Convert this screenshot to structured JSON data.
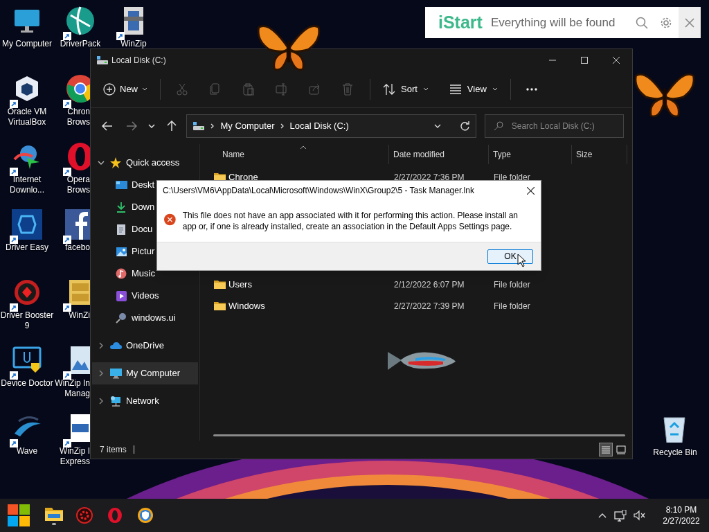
{
  "desktop_columns": [
    [
      {
        "label": "My Computer",
        "shortcut": false
      },
      {
        "label": "Oracle VM VirtualBox",
        "shortcut": true
      },
      {
        "label": "Internet Downlo...",
        "shortcut": true
      },
      {
        "label": "Driver Easy",
        "shortcut": true
      },
      {
        "label": "Driver Booster 9",
        "shortcut": true
      },
      {
        "label": "Device Doctor",
        "shortcut": true
      },
      {
        "label": "Wave",
        "shortcut": true
      }
    ],
    [
      {
        "label": "DriverPack",
        "shortcut": true
      },
      {
        "label": "Chron\nBrows",
        "shortcut": true
      },
      {
        "label": "Opera\nBrows",
        "shortcut": true
      },
      {
        "label": "facebo",
        "shortcut": true
      },
      {
        "label": "WinZi",
        "shortcut": true
      },
      {
        "label": "WinZip In\nManag",
        "shortcut": true
      },
      {
        "label": "WinZip I\nExpress",
        "shortcut": true
      }
    ],
    [
      {
        "label": "WinZip",
        "shortcut": true
      }
    ]
  ],
  "recycle_bin": {
    "label": "Recycle Bin"
  },
  "explorer": {
    "title": "Local Disk (C:)",
    "toolbar": {
      "new": "New",
      "actions": [
        {
          "disabled": true
        },
        {
          "disabled": true
        },
        {
          "disabled": true
        },
        {
          "disabled": true
        },
        {
          "disabled": true
        },
        {
          "disabled": true
        }
      ],
      "sort": "Sort",
      "view": "View"
    },
    "nav": {
      "back_disabled": false,
      "forward_disabled": true
    },
    "breadcrumb": [
      "My Computer",
      "Local Disk (C:)"
    ],
    "search": {
      "placeholder": "Search Local Disk (C:)"
    },
    "sidebar": [
      {
        "label": "Quick access",
        "expanded": true,
        "selected": false,
        "children": [
          {
            "label": "Deskt",
            "selected": false
          },
          {
            "label": "Down",
            "selected": false
          },
          {
            "label": "Docu",
            "selected": false
          },
          {
            "label": "Pictur",
            "selected": false
          },
          {
            "label": "Music",
            "selected": false
          },
          {
            "label": "Videos",
            "selected": false
          },
          {
            "label": "windows.ui",
            "selected": false
          }
        ]
      },
      {
        "label": "OneDrive",
        "expanded": false,
        "selected": false
      },
      {
        "label": "My Computer",
        "expanded": false,
        "selected": true
      },
      {
        "label": "Network",
        "expanded": false,
        "selected": false
      }
    ],
    "columns": [
      "Name",
      "Date modified",
      "Type",
      "Size"
    ],
    "rows": [
      {
        "name": "Chrone",
        "date": "2/27/2022 7:36 PM",
        "type": "File folder"
      },
      {
        "name": "Users",
        "date": "2/12/2022 6:07 PM",
        "type": "File folder"
      },
      {
        "name": "Windows",
        "date": "2/27/2022 7:39 PM",
        "type": "File folder"
      }
    ],
    "status": "7 items",
    "view_buttons": [
      {
        "selected": true
      },
      {
        "selected": false
      }
    ]
  },
  "dialog": {
    "title": "C:\\Users\\VM6\\AppData\\Local\\Microsoft\\Windows\\WinX\\Group2\\5 - Task Manager.lnk",
    "message": "This file does not have an app associated with it for performing this action. Please install an app or, if one is already installed, create an association in the Default Apps Settings page.",
    "button": "OK"
  },
  "istart": {
    "logo": "iStart",
    "placeholder": "Everything will be found"
  },
  "taskbar": {
    "time": "8:10 PM",
    "date": "2/27/2022"
  }
}
